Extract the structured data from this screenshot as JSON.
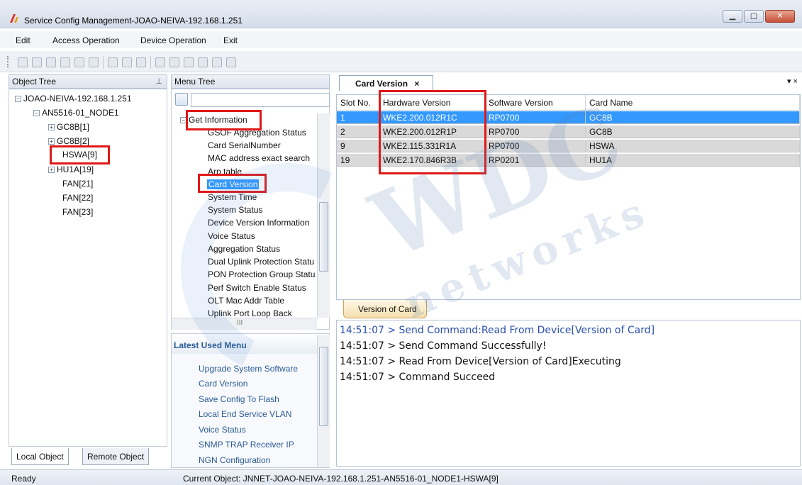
{
  "window": {
    "title": "Service Config Management-JOAO-NEIVA-192.168.1.251",
    "controls": [
      "minimize-icon",
      "maximize-icon",
      "close-icon"
    ]
  },
  "menubar": {
    "items": [
      "Edit",
      "Access Operation",
      "Device Operation",
      "Exit"
    ]
  },
  "object_tree": {
    "header": "Object Tree",
    "root": "JOAO-NEIVA-192.168.1.251",
    "node": "AN5516-01_NODE1",
    "children": [
      "GC8B[1]",
      "GC8B[2]",
      "HSWA[9]",
      "HU1A[19]",
      "FAN[21]",
      "FAN[22]",
      "FAN[23]"
    ],
    "bottom_tabs": [
      "Local Object",
      "Remote Object"
    ]
  },
  "menu_tree": {
    "header": "Menu Tree",
    "group": "Get Information",
    "items": [
      "GSOF Aggregation Status",
      "Card SerialNumber",
      "MAC address exact search",
      "Arp table",
      "Card Version",
      "System Time",
      "System Status",
      "Device Version Information",
      "Voice Status",
      "Aggregation Status",
      "Dual Uplink Protection Statu",
      "PON Protection Group Statu",
      "Perf Switch Enable Status",
      "OLT Mac Addr Table",
      "Uplink Port Loop Back"
    ],
    "scroll_mark": "III"
  },
  "latest_used": {
    "header": "Latest Used Menu",
    "items": [
      "Upgrade System Software",
      "Card Version",
      "Save Config To Flash",
      "Local End Service VLAN",
      "Voice Status",
      "SNMP TRAP Receiver IP",
      "NGN Configuration"
    ]
  },
  "document": {
    "tab_label": "Card Version",
    "tab_close": "×",
    "tab_menu": "▾ ×",
    "columns": [
      "Slot No.",
      "Hardware Version",
      "Software Version",
      "Card Name"
    ],
    "rows": [
      [
        "1",
        "WKE2.200.012R1C",
        "RP0700",
        "GC8B"
      ],
      [
        "2",
        "WKE2.200.012R1P",
        "RP0700",
        "GC8B"
      ],
      [
        "9",
        "WKE2.115.331R1A",
        "RP0700",
        "HSWA"
      ],
      [
        "19",
        "WKE2.170.846R3B",
        "RP0201",
        "HU1A"
      ]
    ],
    "bottom_tab": "Version of Card"
  },
  "log": {
    "lines": [
      "14:51:07 > Send Command:Read From Device[Version of Card]",
      "14:51:07 > Send Command Successfully!",
      "14:51:07 > Read From Device[Version of Card]Executing",
      "14:51:07 > Command Succeed"
    ]
  },
  "status": {
    "state": "Ready",
    "current_object": "Current Object: JNNET-JOAO-NEIVA-192.168.1.251-AN5516-01_NODE1-HSWA[9]"
  },
  "watermark": {
    "text1": "WDC",
    "text2": "networks"
  },
  "colors": {
    "selection": "#3399ff",
    "highlight_box": "#e01818",
    "link": "#2b5b95"
  }
}
